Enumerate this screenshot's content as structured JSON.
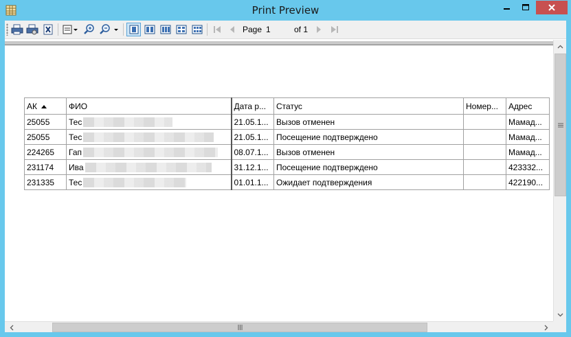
{
  "window": {
    "title": "Print Preview",
    "title_color": "#68c8ec",
    "controls": [
      "minimize-icon",
      "maximize-icon",
      "close-icon"
    ]
  },
  "toolbar": {
    "buttons": [
      "print-icon",
      "print-setup-icon",
      "export-excel-icon",
      "page-setup-dropdown-icon",
      "zoom-in-icon",
      "zoom-out-icon"
    ],
    "layouts": [
      "one-page-icon",
      "two-pages-icon",
      "three-pages-icon",
      "four-pages-icon",
      "six-pages-icon"
    ],
    "nav": [
      "first-page-icon",
      "previous-page-icon",
      "next-page-icon",
      "last-page-icon"
    ],
    "page_label": "Page",
    "page_value": "1",
    "of_label": "of 1"
  },
  "table": {
    "headers": [
      "АК",
      "ФИО",
      "Дата р...",
      "Статус",
      "Номер...",
      "Адрес"
    ],
    "sort_column": "АК",
    "rows": [
      {
        "ak": "25055",
        "fio": "Тес",
        "date": "21.05.1...",
        "status": "Вызов отменен",
        "number": "",
        "address": "Мамад..."
      },
      {
        "ak": "25055",
        "fio": "Тес",
        "date": "21.05.1...",
        "status": "Посещение подтверждено",
        "number": "",
        "address": "Мамад..."
      },
      {
        "ak": "224265",
        "fio": "Гап",
        "date": "08.07.1...",
        "status": "Вызов отменен",
        "number": "",
        "address": "Мамад..."
      },
      {
        "ak": "231174",
        "fio": "Ива",
        "date": "31.12.1...",
        "status": "Посещение подтверждено",
        "number": "",
        "address": "423332..."
      },
      {
        "ak": "231335",
        "fio": "Тес",
        "date": "01.01.1...",
        "status": "Ожидает подтверждения",
        "number": "",
        "address": "422190..."
      }
    ]
  }
}
